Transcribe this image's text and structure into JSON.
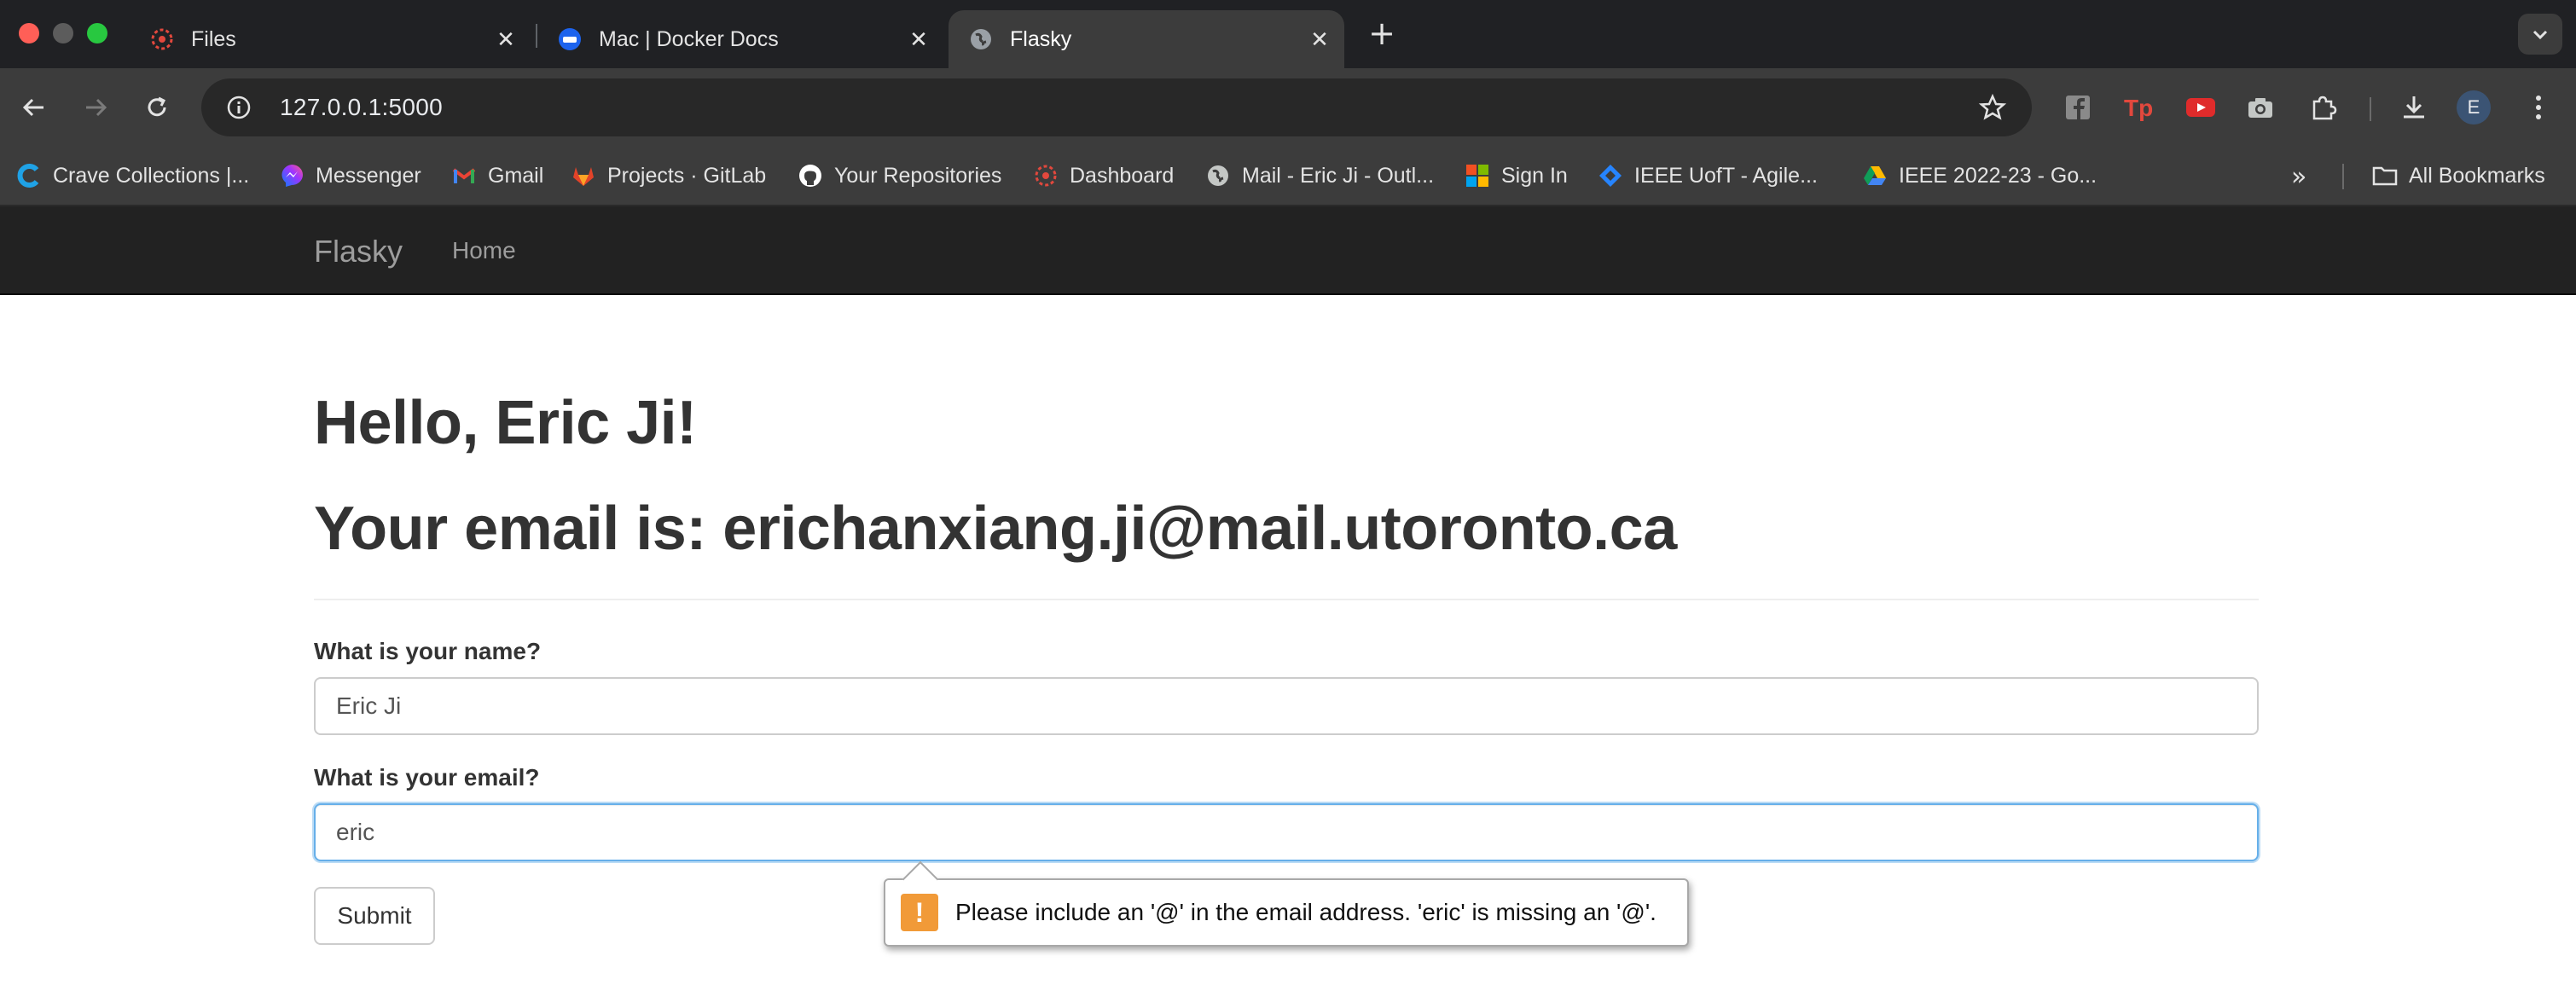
{
  "window": {
    "traffic_lights": {
      "close": "#ff5f57",
      "minimize": "#5c5c5c",
      "maximize": "#28c840"
    }
  },
  "tabs": [
    {
      "title": "Files",
      "icon": "canvas-icon",
      "active": false
    },
    {
      "title": "Mac | Docker Docs",
      "icon": "docker-icon",
      "active": false
    },
    {
      "title": "Flasky",
      "icon": "globe-icon",
      "active": true
    }
  ],
  "toolbar": {
    "url": "127.0.0.1:5000",
    "extensions": [
      "facebook-icon",
      "tp-icon",
      "youtube-icon",
      "camera-icon",
      "puzzle-icon"
    ],
    "avatar_letter": "E"
  },
  "bookmarks": {
    "items": [
      {
        "label": "Crave Collections |...",
        "icon": "crave-icon"
      },
      {
        "label": "Messenger",
        "icon": "messenger-icon"
      },
      {
        "label": "Gmail",
        "icon": "gmail-icon"
      },
      {
        "label": "Projects · GitLab",
        "icon": "gitlab-icon"
      },
      {
        "label": "Your Repositories",
        "icon": "github-icon"
      },
      {
        "label": "Dashboard",
        "icon": "canvas-icon"
      },
      {
        "label": "Mail - Eric Ji - Outl...",
        "icon": "globe-icon"
      },
      {
        "label": "Sign In",
        "icon": "microsoft-icon"
      },
      {
        "label": "IEEE UofT - Agile...",
        "icon": "jira-icon"
      },
      {
        "label": "IEEE 2022-23 - Go...",
        "icon": "drive-icon"
      }
    ],
    "all_bookmarks_label": "All Bookmarks"
  },
  "navbar": {
    "brand": "Flasky",
    "home": "Home"
  },
  "page": {
    "greeting": "Hello, Eric Ji!",
    "email_line": "Your email is: erichanxiang.ji@mail.utoronto.ca",
    "name_label": "What is your name?",
    "name_value": "Eric Ji",
    "email_label": "What is your email?",
    "email_value": "eric",
    "submit_label": "Submit"
  },
  "tooltip": {
    "message": "Please include an '@' in the email address. 'eric' is missing an '@'.",
    "icon_glyph": "!",
    "icon_color": "#f19a38"
  }
}
